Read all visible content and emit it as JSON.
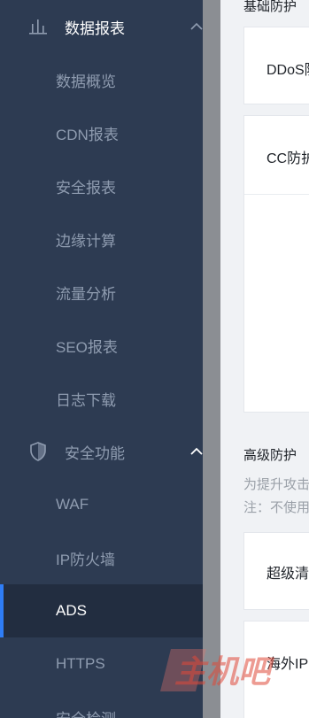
{
  "sidebar": {
    "groups": [
      {
        "label": "数据报表",
        "icon": "bar-chart-icon"
      },
      {
        "label": "安全功能",
        "icon": "shield-icon"
      }
    ],
    "items": [
      {
        "label": "数据概览"
      },
      {
        "label": "CDN报表"
      },
      {
        "label": "安全报表"
      },
      {
        "label": "边缘计算"
      },
      {
        "label": "流量分析"
      },
      {
        "label": "SEO报表"
      },
      {
        "label": "日志下载"
      },
      {
        "label": "WAF"
      },
      {
        "label": "IP防火墙"
      },
      {
        "label": "ADS"
      },
      {
        "label": "HTTPS"
      },
      {
        "label": "安全检测"
      }
    ],
    "active_item": "ADS",
    "accent_color": "#2f7df6"
  },
  "content": {
    "basic_title": "基础防护",
    "basic_cards": [
      {
        "label": "DDoS防护"
      },
      {
        "label": "CC防护"
      }
    ],
    "advanced_title": "高级防护",
    "advanced_desc": [
      "为提升攻击防护能力",
      "注：不使用"
    ],
    "advanced_cards": [
      {
        "label": "超级清洗"
      },
      {
        "label": "海外IP"
      }
    ]
  },
  "watermark": {
    "text": "主机吧"
  }
}
